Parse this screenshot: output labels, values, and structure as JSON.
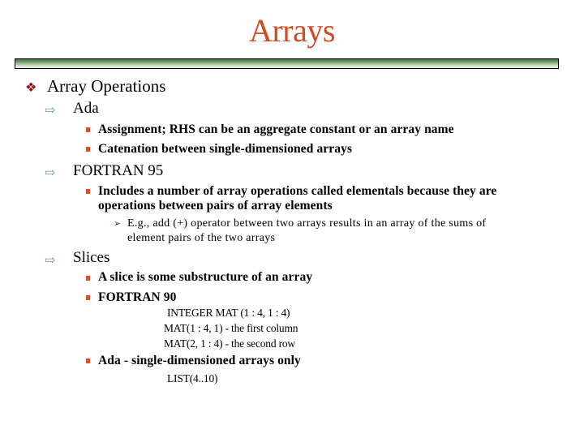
{
  "slide": {
    "title": "Arrays",
    "colors": {
      "title": "#d24b22",
      "level1_bullet": "#8a1a1a",
      "level2_bullet": "#6a9a9a",
      "level3_bullet": "#d8512a",
      "level4_bullet": "#2a2f7a",
      "rule_dark": "#3f6f3a"
    },
    "icons": {
      "level1": "diamond-cluster-bullet-icon",
      "level2": "outline-arrow-bullet-icon",
      "level3": "square-bullet-icon",
      "level4": "arrowhead-bullet-icon"
    },
    "content": {
      "heading": "Array Operations",
      "ada": {
        "label": "Ada",
        "items": [
          "Assignment; RHS can be an aggregate constant or an array name",
          "Catenation between single-dimensioned arrays"
        ]
      },
      "fortran95": {
        "label": "FORTRAN 95",
        "item_line1": "Includes a number of array operations called elementals because they are",
        "item_line2": "operations between pairs of array elements",
        "sub_line1": "E.g., add (+) operator between two arrays results in an array of the sums of",
        "sub_line2": "element pairs of the two arrays"
      },
      "slices": {
        "label": "Slices",
        "items": [
          "A slice is some substructure of an array",
          "FORTRAN 90"
        ],
        "fortran90_code": [
          "INTEGER MAT (1 : 4, 1 : 4)",
          "MAT(1 : 4, 1) - the first column",
          "MAT(2, 1 : 4) - the second row"
        ],
        "ada_item": "Ada - single-dimensioned arrays only",
        "ada_code": "LIST(4..10)"
      }
    }
  }
}
